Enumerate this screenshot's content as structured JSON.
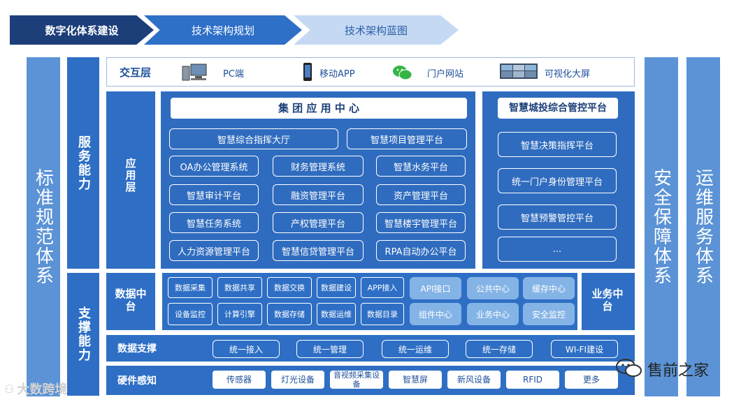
{
  "nav": {
    "step1": "数字化体系建设",
    "step2": "技术架构规划",
    "step3": "技术架构蓝图"
  },
  "left_bars": {
    "standard": "标准规范体系",
    "service": "服务能力",
    "support": "支撑能力"
  },
  "right_bars": {
    "security": "安全保障体系",
    "ops": "运维服务体系"
  },
  "interaction": {
    "label": "交互层",
    "items": [
      {
        "label": "PC端",
        "icon": "desktop-icon"
      },
      {
        "label": "移动APP",
        "icon": "mobile-phone-icon"
      },
      {
        "label": "门户网站",
        "icon": "wechat-icon"
      },
      {
        "label": "可视化大屏",
        "icon": "big-screen-icon"
      }
    ]
  },
  "app_layer": {
    "label": "应用层",
    "group_center": {
      "title": "集 团 应 用 中 心",
      "items": [
        "智慧综合指挥大厅",
        "智慧项目管理平台",
        "OA办公管理系统",
        "财务管理系统",
        "智慧水务平台",
        "智慧审计平台",
        "融资管理平台",
        "资产管理平台",
        "智慧任务系统",
        "产权管理平台",
        "智慧楼宇管理平台",
        "人力资源管理平台",
        "智慧信贷管理平台",
        "RPA自动办公平台"
      ]
    },
    "city_platform": {
      "title": "智慧城投综合管控平台",
      "items": [
        "智慧决策指挥平台",
        "统一门户身份管理平台",
        "智慧预警管控平台",
        "..."
      ]
    }
  },
  "data_middle": {
    "label": "数据中台",
    "items": [
      "数据采集",
      "数据共享",
      "数据交换",
      "数据建设",
      "APP接入",
      "设备监控",
      "计算引擎",
      "数据存储",
      "数据运维",
      "数据目录"
    ]
  },
  "business_middle": {
    "label": "业务中台",
    "items": [
      "API接口",
      "公共中心",
      "缓存中心",
      "组件中心",
      "业务中心",
      "安全监控"
    ]
  },
  "data_support": {
    "label": "数据支撑",
    "items": [
      "统一接入",
      "统一管理",
      "统一运维",
      "统一存储",
      "WI-FI建设"
    ]
  },
  "hardware": {
    "label": "硬件感知",
    "items": [
      "传感器",
      "灯光设备",
      "音视频采集设备",
      "智慧屏",
      "新风设备",
      "RFID",
      "更多"
    ]
  },
  "watermarks": {
    "left": "大数跨境",
    "right": "售前之家"
  },
  "colors": {
    "dark_navy": "#1c3f7a",
    "blue": "#2e6fc5",
    "light_blue": "#5b93d6",
    "pale_blue": "#c5d9f3"
  }
}
